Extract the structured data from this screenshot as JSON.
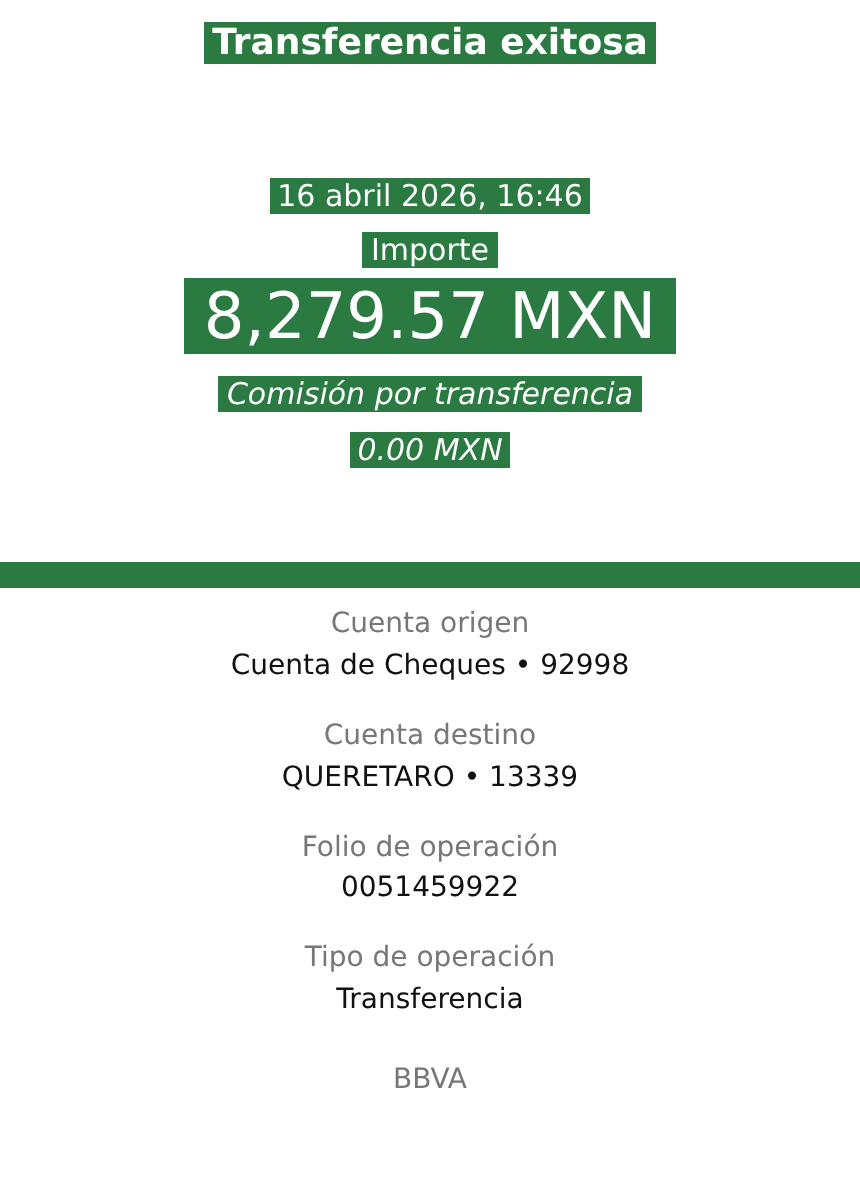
{
  "header": {
    "title": "Transferencia exitosa",
    "date": "16 abril 2026, 16:46",
    "amount_label": "Importe",
    "amount": "8,279.57 MXN",
    "fee_label": "Comisión por transferencia",
    "fee": "0.00 MXN"
  },
  "details": [
    {
      "label": "Cuenta origen",
      "value": "Cuenta de Cheques • 92998"
    },
    {
      "label": "Cuenta destino",
      "value": "QUERETARO • 13339"
    },
    {
      "label": "Folio de operación",
      "value": "0051459922"
    },
    {
      "label": "Tipo de operación",
      "value": "Transferencia"
    }
  ],
  "footer": "BBVA"
}
